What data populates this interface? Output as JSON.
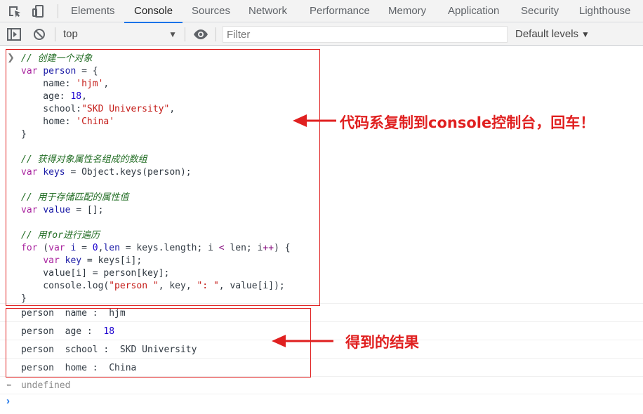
{
  "tabs": [
    {
      "label": "Elements"
    },
    {
      "label": "Console"
    },
    {
      "label": "Sources"
    },
    {
      "label": "Network"
    },
    {
      "label": "Performance"
    },
    {
      "label": "Memory"
    },
    {
      "label": "Application"
    },
    {
      "label": "Security"
    },
    {
      "label": "Lighthouse"
    }
  ],
  "active_tab": "Console",
  "toolbar": {
    "context": "top",
    "filter_placeholder": "Filter",
    "levels": "Default levels"
  },
  "code_lines": [
    [
      [
        "c",
        "// 创建一个对象"
      ]
    ],
    [
      [
        "k",
        "var"
      ],
      [
        "t",
        " "
      ],
      [
        "v",
        "person"
      ],
      [
        "t",
        " = {"
      ]
    ],
    [
      [
        "t",
        "    name: "
      ],
      [
        "s",
        "'hjm'"
      ],
      [
        "t",
        ","
      ]
    ],
    [
      [
        "t",
        "    age: "
      ],
      [
        "n",
        "18"
      ],
      [
        "t",
        ","
      ]
    ],
    [
      [
        "t",
        "    school:"
      ],
      [
        "s",
        "\"SKD University\""
      ],
      [
        "t",
        ","
      ]
    ],
    [
      [
        "t",
        "    home: "
      ],
      [
        "s",
        "'China'"
      ]
    ],
    [
      [
        "t",
        "}"
      ]
    ],
    [
      [
        "t",
        ""
      ]
    ],
    [
      [
        "c",
        "// 获得对象属性名组成的数组"
      ]
    ],
    [
      [
        "k",
        "var"
      ],
      [
        "t",
        " "
      ],
      [
        "v",
        "keys"
      ],
      [
        "t",
        " = Object.keys(person);"
      ]
    ],
    [
      [
        "t",
        ""
      ]
    ],
    [
      [
        "c",
        "// 用于存储匹配的属性值"
      ]
    ],
    [
      [
        "k",
        "var"
      ],
      [
        "t",
        " "
      ],
      [
        "v",
        "value"
      ],
      [
        "t",
        " = [];"
      ]
    ],
    [
      [
        "t",
        ""
      ]
    ],
    [
      [
        "c",
        "// 用for进行遍历"
      ]
    ],
    [
      [
        "k",
        "for"
      ],
      [
        "t",
        " ("
      ],
      [
        "k",
        "var"
      ],
      [
        "t",
        " "
      ],
      [
        "v",
        "i"
      ],
      [
        "t",
        " = "
      ],
      [
        "n",
        "0"
      ],
      [
        "t",
        ","
      ],
      [
        "v",
        "len"
      ],
      [
        "t",
        " = keys.length; i "
      ],
      [
        "p",
        "<"
      ],
      [
        "t",
        " len; i"
      ],
      [
        "p",
        "++"
      ],
      [
        "t",
        ") {"
      ]
    ],
    [
      [
        "t",
        "    "
      ],
      [
        "k",
        "var"
      ],
      [
        "t",
        " "
      ],
      [
        "v",
        "key"
      ],
      [
        "t",
        " = keys[i];"
      ]
    ],
    [
      [
        "t",
        "    value[i] = person[key];"
      ]
    ],
    [
      [
        "t",
        "    console.log("
      ],
      [
        "s",
        "\"person \""
      ],
      [
        "t",
        ", key, "
      ],
      [
        "s",
        "\": \""
      ],
      [
        "t",
        ", value[i]);"
      ]
    ],
    [
      [
        "t",
        "}"
      ]
    ]
  ],
  "log_output": [
    {
      "text": "person  name :  hjm",
      "is_number": false
    },
    {
      "prefix": "person  age :  ",
      "value": "18",
      "is_number": true
    },
    {
      "text": "person  school :  SKD University",
      "is_number": false
    },
    {
      "text": "person  home :  China",
      "is_number": false
    }
  ],
  "result": "undefined",
  "annotations": {
    "code_note": "代码系复制到console控制台，回车！",
    "result_note": "得到的结果"
  },
  "colors": {
    "annotation_red": "#e02020",
    "active_tab_underline": "#1a73e8"
  }
}
